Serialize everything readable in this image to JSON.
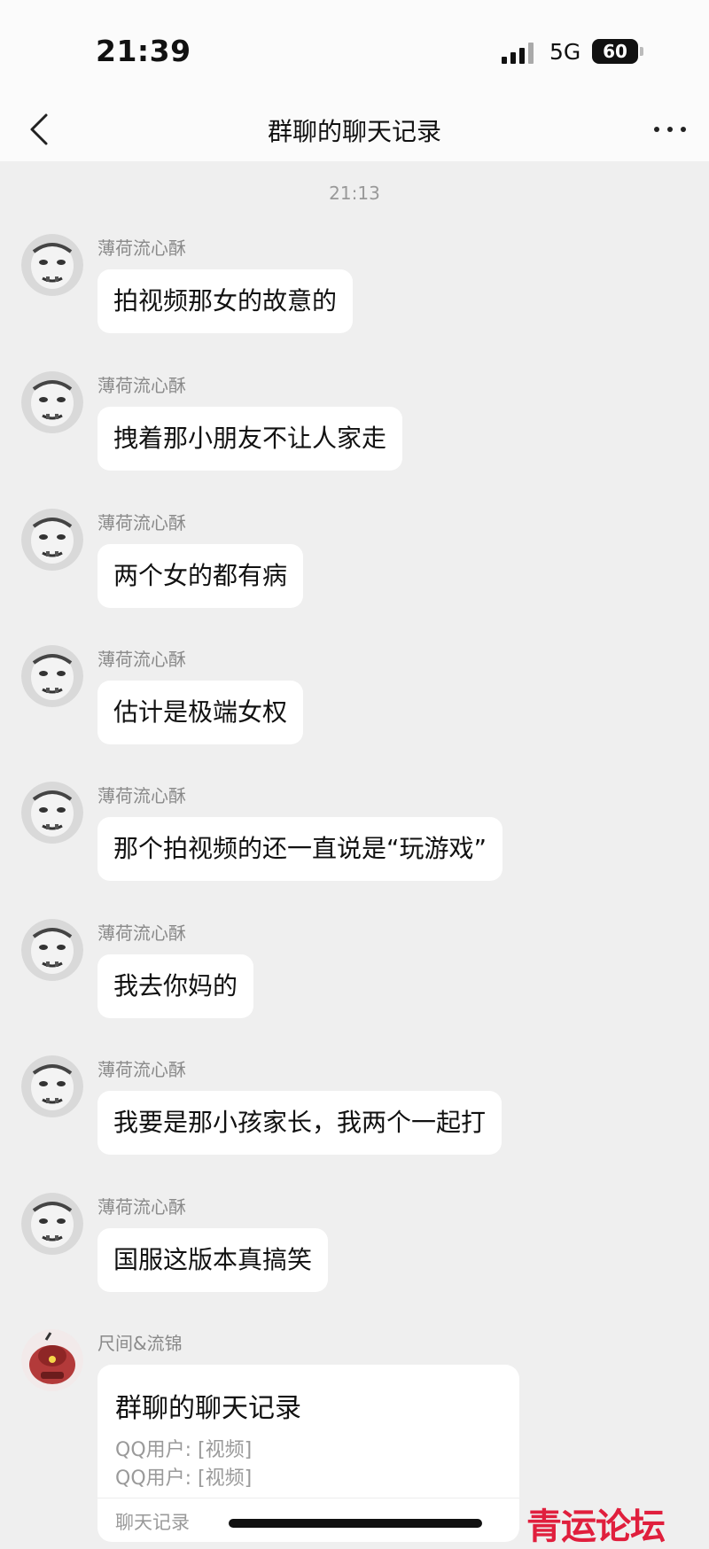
{
  "status_bar": {
    "time": "21:39",
    "network": "5G",
    "battery": "60"
  },
  "nav": {
    "title": "群聊的聊天记录"
  },
  "chat": {
    "timestamp": "21:13",
    "messages": [
      {
        "sender": "薄荷流心酥",
        "text": "拍视频那女的故意的"
      },
      {
        "sender": "薄荷流心酥",
        "text": "拽着那小朋友不让人家走"
      },
      {
        "sender": "薄荷流心酥",
        "text": "两个女的都有病"
      },
      {
        "sender": "薄荷流心酥",
        "text": "估计是极端女权"
      },
      {
        "sender": "薄荷流心酥",
        "text": "那个拍视频的还一直说是“玩游戏”"
      },
      {
        "sender": "薄荷流心酥",
        "text": "我去你妈的"
      },
      {
        "sender": "薄荷流心酥",
        "text": "我要是那小孩家长，我两个一起打"
      },
      {
        "sender": "薄荷流心酥",
        "text": "国服这版本真搞笑"
      }
    ],
    "forward": {
      "sender": "尺间&流锦",
      "title": "群聊的聊天记录",
      "lines": [
        "QQ用户: [视频]",
        "QQ用户: [视频]"
      ],
      "footer": "聊天记录"
    }
  },
  "watermark": "青运论坛"
}
